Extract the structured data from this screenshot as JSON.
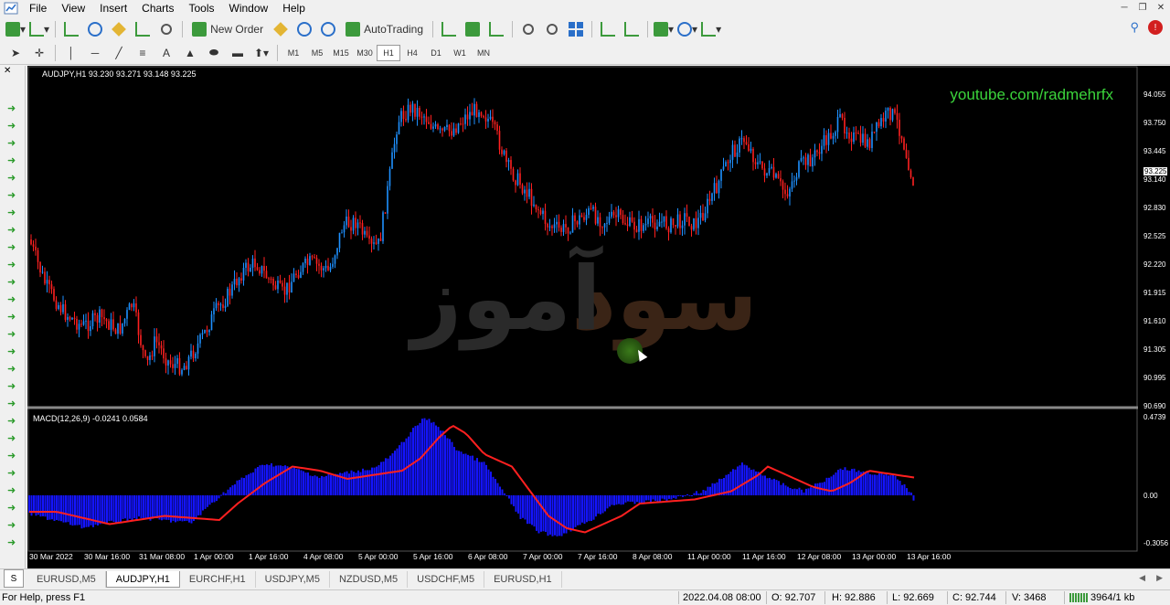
{
  "menu": {
    "items": [
      "File",
      "View",
      "Insert",
      "Charts",
      "Tools",
      "Window",
      "Help"
    ]
  },
  "toolbar": {
    "new_order_label": "New Order",
    "autotrading_label": "AutoTrading",
    "timeframes": [
      "M1",
      "M5",
      "M15",
      "M30",
      "H1",
      "H4",
      "D1",
      "W1",
      "MN"
    ],
    "active_timeframe": "H1"
  },
  "chart": {
    "symbol_header": "AUDJPY,H1  93.230 93.271 93.148 93.225",
    "macd_header": "MACD(12,26,9) -0.0241 0.0584",
    "youtube_text": "youtube.com/radmehrfx",
    "watermark_left": "آموز",
    "watermark_right": "سود",
    "current_price": "93.225",
    "price_ticks": [
      "94.055",
      "93.750",
      "93.445",
      "93.140",
      "92.830",
      "92.525",
      "92.220",
      "91.915",
      "91.610",
      "91.305",
      "90.995",
      "90.690"
    ],
    "macd_ticks": [
      "0.4739",
      "0.00",
      "-0.3056"
    ],
    "time_ticks": [
      "30 Mar 2022",
      "30 Mar 16:00",
      "31 Mar 08:00",
      "1 Apr 00:00",
      "1 Apr 16:00",
      "4 Apr 08:00",
      "5 Apr 00:00",
      "5 Apr 16:00",
      "6 Apr 08:00",
      "7 Apr 00:00",
      "7 Apr 16:00",
      "8 Apr 08:00",
      "11 Apr 00:00",
      "11 Apr 16:00",
      "12 Apr 08:00",
      "13 Apr 00:00",
      "13 Apr 16:00"
    ],
    "colors": {
      "background": "#000000",
      "up": "#1e90ff",
      "down": "#ff2020",
      "macd_hist": "#1414ff",
      "signal": "#ff2020",
      "youtube": "#3bd43b"
    }
  },
  "tabs": {
    "left_label": "S",
    "items": [
      "EURUSD,M5",
      "AUDJPY,H1",
      "EURCHF,H1",
      "USDJPY,M5",
      "NZDUSD,M5",
      "USDCHF,M5",
      "EURUSD,H1"
    ],
    "active": "AUDJPY,H1"
  },
  "status": {
    "help": "For Help, press F1",
    "datetime": "2022.04.08 08:00",
    "open": "O: 92.707",
    "high": "H: 92.886",
    "low": "L: 92.669",
    "close": "C: 92.744",
    "volume": "V: 3468",
    "connection": "3964/1 kb"
  }
}
